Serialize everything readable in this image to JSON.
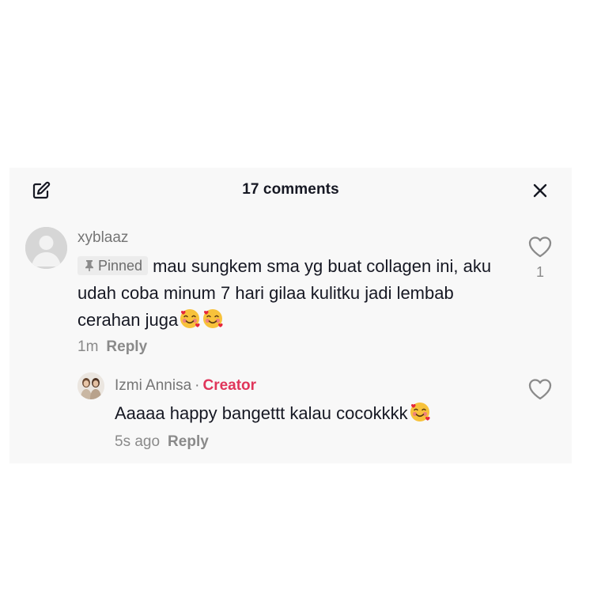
{
  "header": {
    "title": "17 comments",
    "edit_icon": "edit-icon",
    "close_icon": "close-icon"
  },
  "comment": {
    "username": "xyblaaz",
    "pinned_label": "Pinned",
    "text": "mau sungkem sma yg buat collagen ini, aku udah coba minum 7 hari gilaa kulitku jadi lembab cerahan juga",
    "emojis": [
      "smiling-face-with-hearts",
      "smiling-face-with-hearts"
    ],
    "time": "1m",
    "reply_label": "Reply",
    "like_count": "1"
  },
  "reply": {
    "username": "Izmi Annisa",
    "separator": "·",
    "badge": "Creator",
    "text": "Aaaaa happy bangettt kalau cocokkkk",
    "emojis": [
      "smiling-face-with-hearts"
    ],
    "time": "5s ago",
    "reply_label": "Reply"
  },
  "colors": {
    "panel_bg": "#f8f8f8",
    "creator": "#e0355a",
    "muted": "#8a8a8a"
  }
}
